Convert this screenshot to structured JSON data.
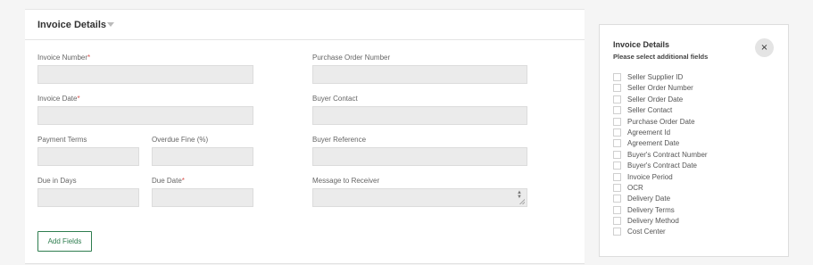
{
  "form": {
    "title": "Invoice Details",
    "required_mark": "*",
    "labels": {
      "invoice_number": "Invoice Number",
      "purchase_order_number": "Purchase Order Number",
      "invoice_date": "Invoice Date",
      "buyer_contact": "Buyer Contact",
      "payment_terms": "Payment Terms",
      "overdue_fine": "Overdue Fine (%)",
      "buyer_reference": "Buyer Reference",
      "due_in_days": "Due in Days",
      "due_date": "Due Date",
      "message_to_receiver": "Message to Receiver"
    },
    "values": {
      "invoice_number": "",
      "purchase_order_number": "",
      "invoice_date": "",
      "buyer_contact": "",
      "payment_terms": "",
      "overdue_fine": "",
      "buyer_reference": "",
      "due_in_days": "",
      "due_date": "",
      "message_to_receiver": ""
    },
    "add_fields_label": "Add Fields",
    "colors": {
      "accent": "#2e7d4f",
      "required": "#d9534f",
      "input_bg": "#ebebeb"
    }
  },
  "panel": {
    "title": "Invoice Details",
    "subtitle": "Please select additional fields",
    "close_label": "×",
    "fields": [
      {
        "label": "Seller Supplier ID",
        "checked": false
      },
      {
        "label": "Seller Order Number",
        "checked": false
      },
      {
        "label": "Seller Order Date",
        "checked": false
      },
      {
        "label": "Seller Contact",
        "checked": false
      },
      {
        "label": "Purchase Order Date",
        "checked": false
      },
      {
        "label": "Agreement Id",
        "checked": false
      },
      {
        "label": "Agreement Date",
        "checked": false
      },
      {
        "label": "Buyer's Contract Number",
        "checked": false
      },
      {
        "label": "Buyer's Contract Date",
        "checked": false
      },
      {
        "label": "Invoice Period",
        "checked": false
      },
      {
        "label": "OCR",
        "checked": false
      },
      {
        "label": "Delivery Date",
        "checked": false
      },
      {
        "label": "Delivery Terms",
        "checked": false
      },
      {
        "label": "Delivery Method",
        "checked": false
      },
      {
        "label": "Cost Center",
        "checked": false
      }
    ]
  }
}
